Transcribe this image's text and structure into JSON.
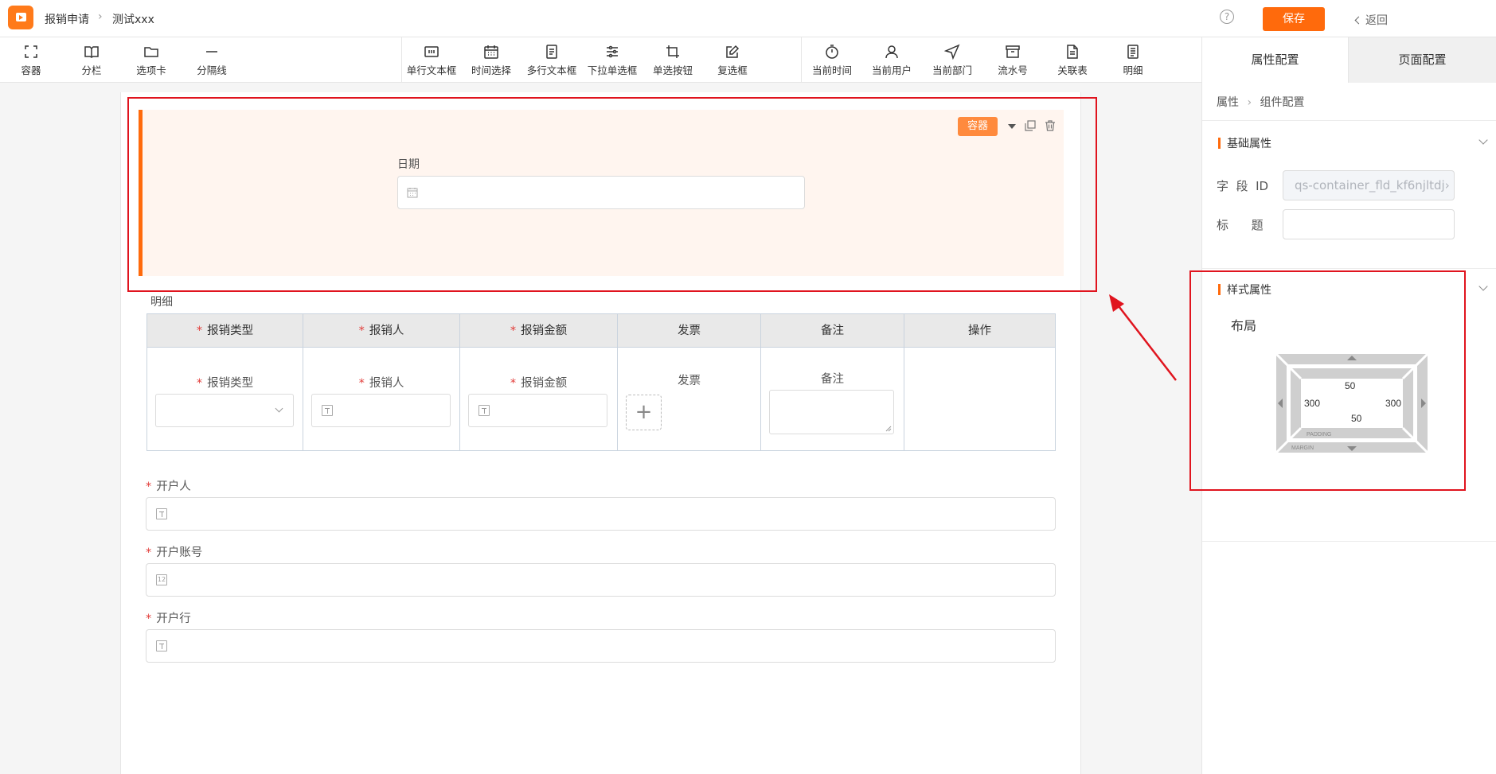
{
  "header": {
    "breadcrumb": [
      "报销申请",
      "测试xxx"
    ],
    "help": "?",
    "save_label": "保存",
    "back_label": "返回"
  },
  "toolbar": {
    "layout_tools": [
      "容器",
      "分栏",
      "选项卡",
      "分隔线"
    ],
    "form_tools": [
      "单行文本框",
      "时间选择",
      "多行文本框",
      "下拉单选框",
      "单选按钮",
      "复选框"
    ],
    "system_tools": [
      "当前时间",
      "当前用户",
      "当前部门",
      "流水号",
      "关联表",
      "明细"
    ]
  },
  "right_tabs": [
    "属性配置",
    "页面配置"
  ],
  "right_panel": {
    "breadcrumb": [
      "属性",
      "组件配置"
    ],
    "basic_section": "基础属性",
    "field_id_label": "字  段  ID",
    "field_id_value": "qs-container_fld_kf6njltdj›",
    "title_label": "标      题",
    "title_value": "",
    "style_section": "样式属性",
    "layout_label": "布局",
    "box_model": {
      "padding_top": "50",
      "padding_bottom": "50",
      "padding_left": "300",
      "padding_right": "300",
      "padding_caption": "PADDING",
      "margin_caption": "MARGIN"
    }
  },
  "canvas": {
    "container_tag": "容器",
    "date_label": "日期",
    "detail_label": "明细",
    "detail_columns": [
      "报销类型",
      "报销人",
      "报销金额",
      "发票",
      "备注",
      "操作"
    ],
    "detail_required": [
      true,
      true,
      true,
      false,
      false,
      false
    ],
    "detail_cells": [
      "报销类型",
      "报销人",
      "报销金额",
      "发票",
      "备注"
    ],
    "upload_plus": "+",
    "account_holder_label": "开户人",
    "account_number_label": "开户账号",
    "bank_label": "开户行",
    "required_mark": "*",
    "number_icon_text": "12"
  },
  "colors": {
    "accent": "#ff6a0c",
    "container_bg": "#fff5ef",
    "annotation_red": "#e0141e",
    "required": "#e23c39"
  }
}
